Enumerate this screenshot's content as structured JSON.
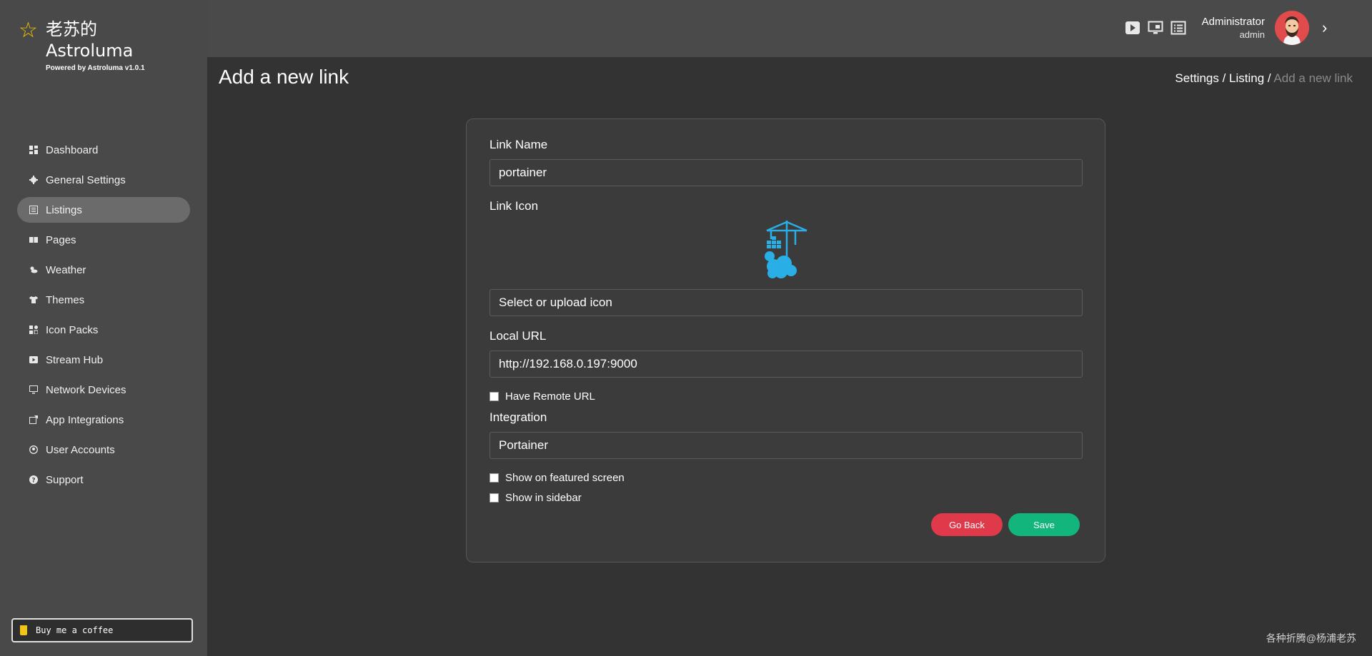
{
  "brand": {
    "title_line1": "老苏的",
    "title_line2": "Astroluma",
    "subtitle": "Powered by Astroluma v1.0.1"
  },
  "sidebar": {
    "items": [
      {
        "label": "Dashboard",
        "icon": "dashboard-icon"
      },
      {
        "label": "General Settings",
        "icon": "gear-icon"
      },
      {
        "label": "Listings",
        "icon": "list-icon",
        "active": true
      },
      {
        "label": "Pages",
        "icon": "book-icon"
      },
      {
        "label": "Weather",
        "icon": "weather-icon"
      },
      {
        "label": "Themes",
        "icon": "shirt-icon"
      },
      {
        "label": "Icon Packs",
        "icon": "icon-packs-icon"
      },
      {
        "label": "Stream Hub",
        "icon": "play-icon"
      },
      {
        "label": "Network Devices",
        "icon": "monitor-icon"
      },
      {
        "label": "App Integrations",
        "icon": "external-link-icon"
      },
      {
        "label": "User Accounts",
        "icon": "user-circle-icon"
      },
      {
        "label": "Support",
        "icon": "question-icon"
      }
    ],
    "coffee_label": "Buy me a coffee"
  },
  "topbar": {
    "role": "Administrator",
    "username": "admin"
  },
  "page": {
    "title": "Add a new link",
    "breadcrumb": [
      "Settings /",
      "Listing /",
      "Add a new link"
    ]
  },
  "form": {
    "link_name_label": "Link Name",
    "link_name_value": "portainer",
    "link_icon_label": "Link Icon",
    "icon_select_value": "Select or upload icon",
    "local_url_label": "Local URL",
    "local_url_value": "http://192.168.0.197:9000",
    "remote_url_label": "Have Remote URL",
    "integration_label": "Integration",
    "integration_value": "Portainer",
    "featured_label": "Show on featured screen",
    "sidebar_label": "Show in sidebar",
    "go_back": "Go Back",
    "save": "Save"
  },
  "colors": {
    "accent_save": "#12b67c",
    "accent_back": "#e0394a",
    "star": "#f2c200"
  },
  "watermark": "各种折腾@杨浦老苏"
}
